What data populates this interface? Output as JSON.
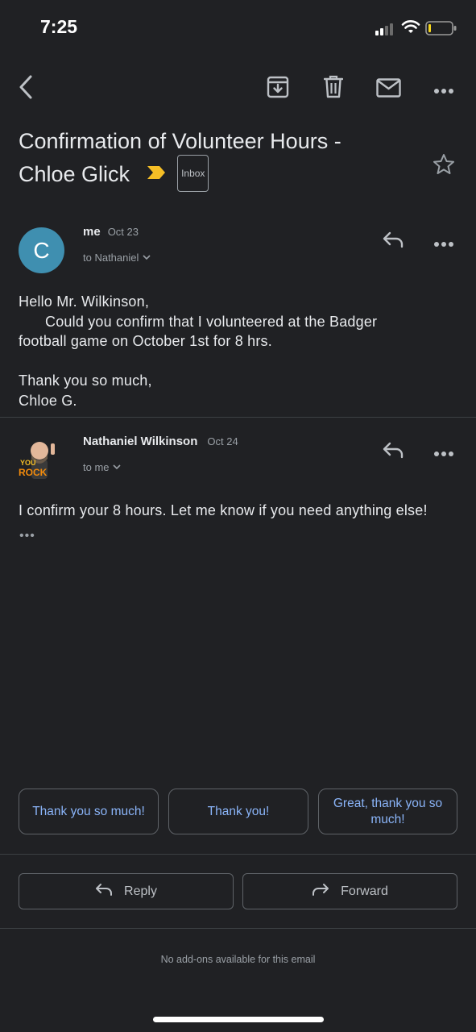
{
  "status_bar": {
    "time": "7:25"
  },
  "toolbar": {
    "back_icon": "chevron-left-icon",
    "archive_icon": "archive-icon",
    "delete_icon": "trash-icon",
    "mark_unread_icon": "mail-icon",
    "more_icon": "more-horizontal-icon"
  },
  "subject": {
    "line1": "Confirmation of Volunteer Hours -",
    "line2": "Chloe Glick",
    "label": "Inbox"
  },
  "messages": [
    {
      "sender": "me",
      "date": "Oct 23",
      "to": "to Nathaniel",
      "avatar_letter": "C",
      "body": [
        "Hello Mr. Wilkinson,",
        "Could you confirm that I volunteered at the Badger",
        "football game on October 1st for 8 hrs.",
        "Thank you so much,",
        "Chloe G."
      ]
    },
    {
      "sender": "Nathaniel Wilkinson",
      "date": "Oct 24",
      "to": "to me",
      "avatar_text": "YOU ROCK",
      "body": [
        "I confirm your 8 hours. Let me know if you need anything else!"
      ],
      "quoted": "•••"
    }
  ],
  "smart_replies": [
    "Thank you so much!",
    "Thank you!",
    "Great, thank you so much!"
  ],
  "actions": {
    "reply": "Reply",
    "forward": "Forward"
  },
  "footer": "No add-ons available for this email",
  "colors": {
    "background": "#202124",
    "accent": "#8ab4f8",
    "avatar": "#3f8fb0",
    "important": "#f6bf26"
  }
}
